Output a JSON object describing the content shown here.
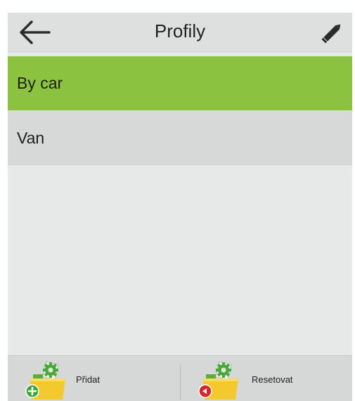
{
  "header": {
    "title": "Profily",
    "back_icon": "arrow-left-icon",
    "edit_icon": "pencil-icon"
  },
  "profiles": [
    {
      "label": "By car",
      "selected": true
    },
    {
      "label": "Van",
      "selected": false
    }
  ],
  "footer": {
    "add_label": "Přidat",
    "add_icon": "folder-add-icon",
    "reset_label": "Resetovat",
    "reset_icon": "folder-reset-icon"
  },
  "colors": {
    "selected": "#8bc240",
    "item": "#d7d8d8",
    "background": "#e7e8e8",
    "add_badge": "#3aa636",
    "reset_badge": "#d8242c"
  }
}
